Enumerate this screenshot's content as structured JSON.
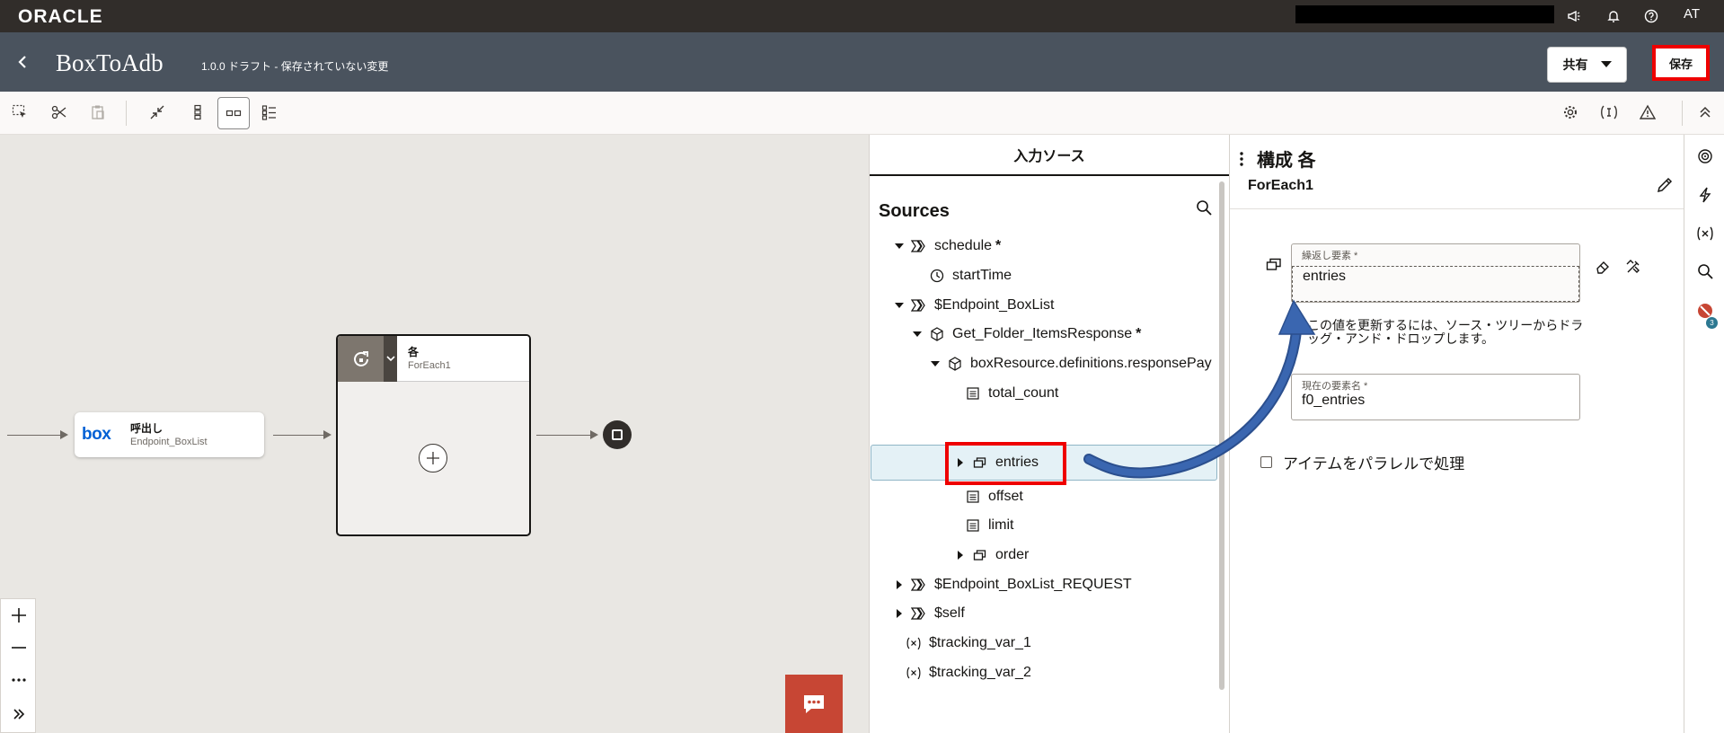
{
  "header": {
    "logo": "ORACLE",
    "avatar": "AT",
    "app_title": "BoxToAdb",
    "app_subtitle": "1.0.0 ドラフト - 保存されていない変更",
    "share_label": "共有",
    "save_label": "保存"
  },
  "canvas": {
    "call_node": {
      "logo": "box",
      "title": "呼出し",
      "subtitle": "Endpoint_BoxList"
    },
    "each_node": {
      "title": "各",
      "subtitle": "ForEach1"
    }
  },
  "sources": {
    "tab_label": "入力ソース",
    "title": "Sources",
    "tree": [
      {
        "label": "schedule",
        "required": "*"
      },
      {
        "label": "startTime"
      },
      {
        "label": "$Endpoint_BoxList"
      },
      {
        "label": "Get_Folder_ItemsResponse",
        "required": "*"
      },
      {
        "label": "boxResource.definitions.responsePay"
      },
      {
        "label": "total_count"
      },
      {
        "label": "entries"
      },
      {
        "label": "offset"
      },
      {
        "label": "limit"
      },
      {
        "label": "order"
      },
      {
        "label": "$Endpoint_BoxList_REQUEST"
      },
      {
        "label": "$self"
      },
      {
        "label": "$tracking_var_1"
      },
      {
        "label": "$tracking_var_2"
      }
    ]
  },
  "config": {
    "title": "構成 各",
    "subtitle": "ForEach1",
    "repeat_field": {
      "label": "繰返し要素 *",
      "value": "entries"
    },
    "hint": "この値を更新するには、ソース・ツリーからドラッグ・アンド・ドロップします。",
    "current_field": {
      "label": "現在の要素名 *",
      "value": "f0_entries"
    },
    "parallel_label": "アイテムをパラレルで処理"
  },
  "rail": {
    "badge_count": "3"
  },
  "colors": {
    "topbar": "#312d2a",
    "header": "#4a535e",
    "highlight_red": "#ee0000",
    "chat": "#c74634",
    "arrow_blue": "#3a66b0"
  }
}
